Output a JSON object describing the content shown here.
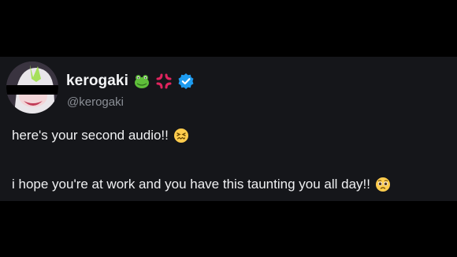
{
  "post": {
    "display_name": "kerogaki",
    "handle": "@kerogaki",
    "badges": [
      "frog-emoji",
      "anger-symbol-emoji",
      "verified-badge"
    ],
    "line1": "here's your second audio!!",
    "line1_emoji": "confounded-face-emoji",
    "line2": "i hope you're at work and you have this taunting you all day!!",
    "line2_emoji": "pleading-face-emoji"
  },
  "colors": {
    "background": "#000000",
    "card": "#15161a",
    "text": "#f0f1f3",
    "handle": "#8b8f96",
    "verified": "#1d9bf0",
    "anger": "#e0245e",
    "frog": "#5fbf3a"
  }
}
